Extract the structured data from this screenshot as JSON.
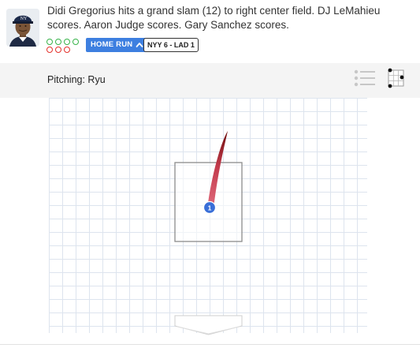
{
  "play": {
    "description": "Didi Gregorius hits a grand slam (12) to right center field. DJ LeMahieu scores. Aaron Judge scores. Gary Sanchez scores.",
    "result_badge": "HOME RUN",
    "score_badge": "NYY 6 - LAD 1",
    "colors": {
      "badge": "#3d7fe0",
      "out_green": "#38b44a",
      "out_red": "#e4312b"
    }
  },
  "avatar": {
    "cap_logo": "NY"
  },
  "pitching": {
    "label": "Pitching: Ryu"
  },
  "controls": {
    "list_icon": "list-icon",
    "zone_icon": "strike-zone-icon"
  },
  "pitches": [
    {
      "number": "1",
      "type_color": "#e05a6e",
      "trail_color": "#8b1a1a"
    }
  ]
}
